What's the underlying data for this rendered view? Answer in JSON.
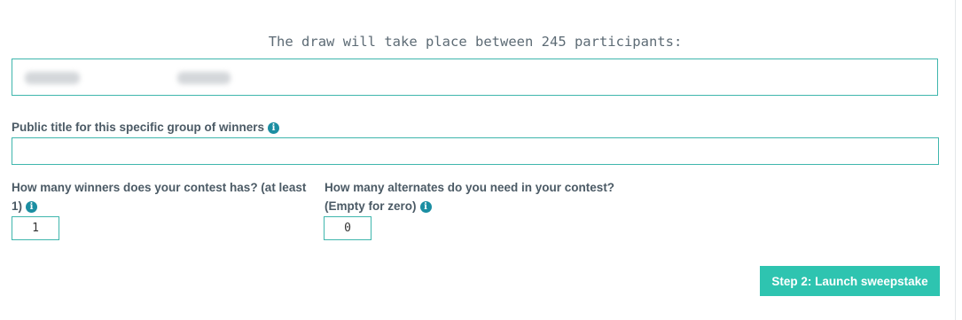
{
  "heading": "The draw will take place between 245 participants:",
  "public_title": {
    "label": "Public title for this specific group of winners",
    "value": ""
  },
  "winners": {
    "label_line1": "How many winners does your contest has? (at least",
    "label_line2": "1)",
    "value": "1"
  },
  "alternates": {
    "label_line1": "How many alternates do you need in your contest?",
    "label_line2": "(Empty for zero)",
    "value": "0"
  },
  "info_icon_glyph": "i",
  "launch_button": "Step 2: Launch sweepstake",
  "colors": {
    "accent": "#2ec4b0",
    "border": "#3fb6ad",
    "info": "#1b8ea2"
  }
}
